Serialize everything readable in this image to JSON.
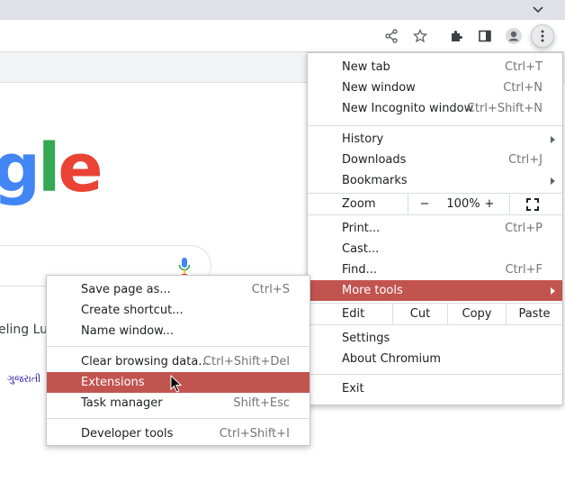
{
  "toolbar": {
    "icons": [
      "share-icon",
      "star-icon",
      "puzzle-icon",
      "sidepanel-icon",
      "profile-icon",
      "kebab-menu-icon"
    ]
  },
  "page": {
    "logo_fragment": {
      "g": "g",
      "l": "l",
      "e": "e"
    },
    "lucky_fragment": "eling Luc",
    "language_link": "ગુજરાતી",
    "colors": {
      "blue": "#4285f4",
      "green": "#34a853",
      "red": "#ea4335"
    }
  },
  "main_menu": {
    "new_tab": {
      "label": "New tab",
      "shortcut": "Ctrl+T"
    },
    "new_window": {
      "label": "New window",
      "shortcut": "Ctrl+N"
    },
    "new_incognito": {
      "label": "New Incognito window",
      "shortcut": "Ctrl+Shift+N"
    },
    "history": {
      "label": "History"
    },
    "downloads": {
      "label": "Downloads",
      "shortcut": "Ctrl+J"
    },
    "bookmarks": {
      "label": "Bookmarks"
    },
    "zoom": {
      "label": "Zoom",
      "minus": "−",
      "value": "100%",
      "plus": "+"
    },
    "print": {
      "label": "Print...",
      "shortcut": "Ctrl+P"
    },
    "cast": {
      "label": "Cast..."
    },
    "find": {
      "label": "Find...",
      "shortcut": "Ctrl+F"
    },
    "more_tools": {
      "label": "More tools"
    },
    "edit": {
      "label": "Edit",
      "cut": "Cut",
      "copy": "Copy",
      "paste": "Paste"
    },
    "settings": {
      "label": "Settings"
    },
    "about": {
      "label": "About Chromium"
    },
    "exit": {
      "label": "Exit"
    }
  },
  "submenu": {
    "save_page": {
      "label": "Save page as...",
      "shortcut": "Ctrl+S"
    },
    "create_shortcut": {
      "label": "Create shortcut..."
    },
    "name_window": {
      "label": "Name window..."
    },
    "clear_browsing": {
      "label": "Clear browsing data...",
      "shortcut": "Ctrl+Shift+Del"
    },
    "extensions": {
      "label": "Extensions"
    },
    "task_manager": {
      "label": "Task manager",
      "shortcut": "Shift+Esc"
    },
    "developer_tools": {
      "label": "Developer tools",
      "shortcut": "Ctrl+Shift+I"
    }
  },
  "highlight_color": "#c25450"
}
